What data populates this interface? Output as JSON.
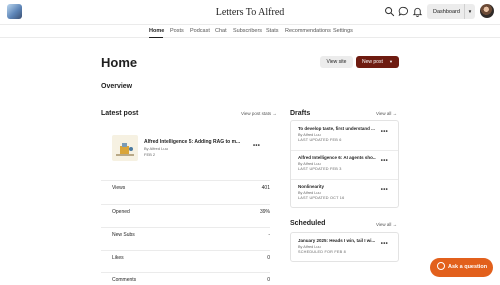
{
  "header": {
    "publication_title": "Letters To Alfred",
    "dashboard_label": "Dashboard",
    "icons": [
      "search-icon",
      "chat-bubble-icon",
      "bell-icon"
    ]
  },
  "nav": {
    "items": [
      {
        "label": "Home",
        "active": true
      },
      {
        "label": "Posts"
      },
      {
        "label": "Podcast"
      },
      {
        "label": "Chat"
      },
      {
        "label": "Subscribers"
      },
      {
        "label": "Stats"
      },
      {
        "label": "Recommendations"
      },
      {
        "label": "Settings"
      }
    ]
  },
  "page": {
    "title": "Home",
    "view_site_label": "View site",
    "new_post_label": "New post",
    "overview_label": "Overview"
  },
  "latest_post": {
    "section_title": "Latest post",
    "stats_link": "View post stats →",
    "post": {
      "title": "Alfred Intelligence 5: Adding RAG to m...",
      "author": "By Alfred Luu",
      "date": "FEB 2"
    },
    "stats": [
      {
        "label": "Views",
        "value": "401"
      },
      {
        "label": "Opened",
        "value": "39%"
      },
      {
        "label": "New Subs",
        "value": "-"
      },
      {
        "label": "Likes",
        "value": "0"
      },
      {
        "label": "Comments",
        "value": "0"
      }
    ]
  },
  "drafts": {
    "section_title": "Drafts",
    "view_all": "View all →",
    "items": [
      {
        "title": "To develop taste, first understand ...",
        "author": "By Alfred Luu",
        "updated": "LAST UPDATED FEB 6"
      },
      {
        "title": "Alfred Intelligence 6: AI agents sho...",
        "author": "By Alfred Luu",
        "updated": "LAST UPDATED FEB 3"
      },
      {
        "title": "Nonlinearity",
        "author": "By Alfred Luu",
        "updated": "LAST UPDATED OCT 16"
      }
    ]
  },
  "scheduled": {
    "section_title": "Scheduled",
    "view_all": "View all →",
    "items": [
      {
        "title": "January 2025: Heads I win, tail I wi...",
        "author": "By Alfred Luu",
        "updated": "SCHEDULED FOR FEB 8"
      }
    ]
  },
  "ask_button": {
    "label": "Ask a question"
  },
  "colors": {
    "accent": "#6e1b10",
    "ask": "#e2601c"
  }
}
